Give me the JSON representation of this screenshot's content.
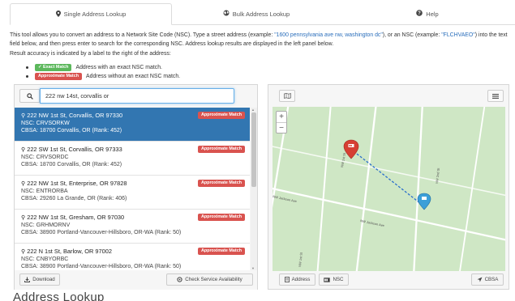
{
  "tabs": [
    {
      "label": "Single Address Lookup",
      "icon": "map-marker-icon",
      "active": true
    },
    {
      "label": "Bulk Address Lookup",
      "icon": "globe-icon",
      "active": false
    },
    {
      "label": "Help",
      "icon": "question-icon",
      "active": false
    }
  ],
  "intro": {
    "part1": "This tool allows you to convert an address to a Network Site Code (NSC). Type a street address (example: ",
    "example1": "\"1600 pennsylvania ave nw, washington dc\"",
    "part2": "), or an NSC (example: ",
    "example2": "\"FLCHVAEO\"",
    "part3": ") into the text field below, and then press enter to search for the corresponding NSC. Address lookup results are displayed in the left panel below."
  },
  "accuracy_text": "Result accuracy is indicated by a label to the right of the address:",
  "legend": [
    {
      "badge": "✓ Exact Match",
      "text": "Address with an exact NSC match.",
      "color": "#5cb85c"
    },
    {
      "badge": "Approximate Match",
      "text": "Address without an exact NSC match.",
      "color": "#d9534f"
    }
  ],
  "search": {
    "value": "222 nw 14st, corvallis or"
  },
  "results": [
    {
      "address": "222 NW 1st St, Corvallis, OR 97330",
      "nsc": "NSC: CRVSORKW",
      "cbsa": "CBSA: 18700 Corvallis, OR (Rank: 452)",
      "badge": "Approximate Match",
      "selected": true
    },
    {
      "address": "222 SW 1st St, Corvallis, OR 97333",
      "nsc": "NSC: CRVSORDC",
      "cbsa": "CBSA: 18700 Corvallis, OR (Rank: 452)",
      "badge": "Approximate Match",
      "selected": false
    },
    {
      "address": "222 NW 1st St, Enterprise, OR 97828",
      "nsc": "NSC: ENTRORBA",
      "cbsa": "CBSA: 29260 La Grande, OR (Rank: 406)",
      "badge": "Approximate Match",
      "selected": false
    },
    {
      "address": "222 NW 1st St, Gresham, OR 97030",
      "nsc": "NSC: GRHMORNV",
      "cbsa": "CBSA: 38900 Portland-Vancouver-Hillsboro, OR-WA (Rank: 50)",
      "badge": "Approximate Match",
      "selected": false
    },
    {
      "address": "222 N 1st St, Barlow, OR 97002",
      "nsc": "NSC: CNBYORBC",
      "cbsa": "CBSA: 38900 Portland-Vancouver-Hillsboro, OR-WA (Rank: 50)",
      "badge": "Approximate Match",
      "selected": false
    }
  ],
  "left_buttons": {
    "download": "Download",
    "service": "Check Service Availability"
  },
  "map_buttons": {
    "address": "Address",
    "nsc": "NSC",
    "cbsa": "CBSA"
  },
  "map_labels": {
    "street1": "NW Jackson Ave",
    "street2": "NW Jackson Ave",
    "street3": "NW 1st St",
    "street4": "NW 2nd St",
    "street5": "NW 1st St"
  },
  "zoom": {
    "in": "+",
    "out": "−"
  },
  "colors": {
    "selected_row": "#3276b1",
    "approx_badge": "#d9534f",
    "exact_badge": "#5cb85c",
    "map_bg": "#cfe7c5",
    "link": "#2a6ebb"
  },
  "caption": "Address Lookup"
}
